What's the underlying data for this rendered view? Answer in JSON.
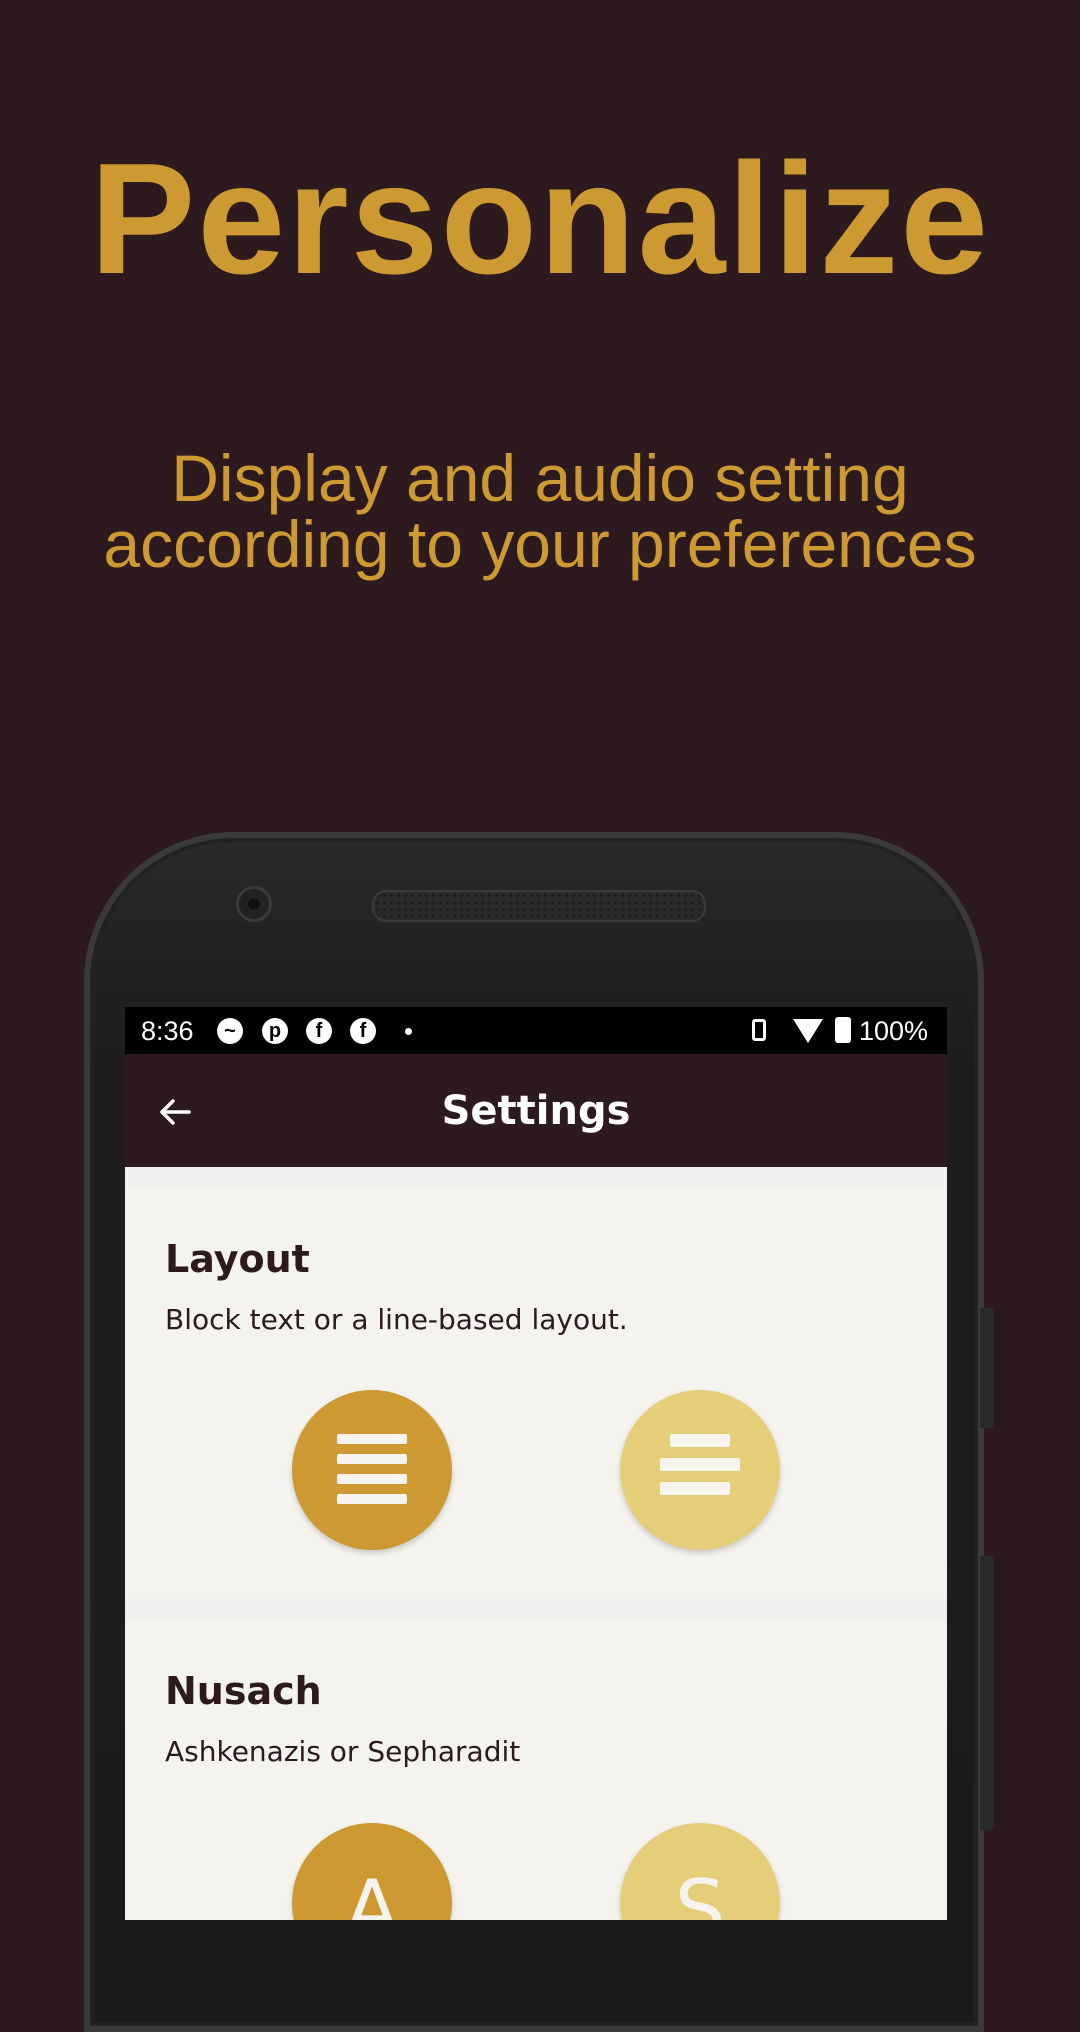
{
  "promo": {
    "headline": "Personalize",
    "subline_line1": "Display and audio setting",
    "subline_line2": "according to your preferences"
  },
  "statusbar": {
    "time": "8:36",
    "notification_icons": [
      "messenger-icon",
      "notification-app-icon",
      "facebook-icon",
      "facebook-icon"
    ],
    "battery": "100%"
  },
  "appbar": {
    "title": "Settings",
    "back_icon": "arrow-left-icon"
  },
  "settings": {
    "layout": {
      "title": "Layout",
      "description": "Block text or a line-based layout.",
      "options": [
        "block-layout-icon",
        "line-layout-icon"
      ]
    },
    "nusach": {
      "title": "Nusach",
      "description": "Ashkenazis or Sepharadit",
      "option_a": "A",
      "option_s": "S"
    }
  },
  "colors": {
    "background": "#2d1a1e",
    "accent": "#cc9932",
    "accent_light": "#e6cd7a",
    "card": "#f4f3ee"
  }
}
